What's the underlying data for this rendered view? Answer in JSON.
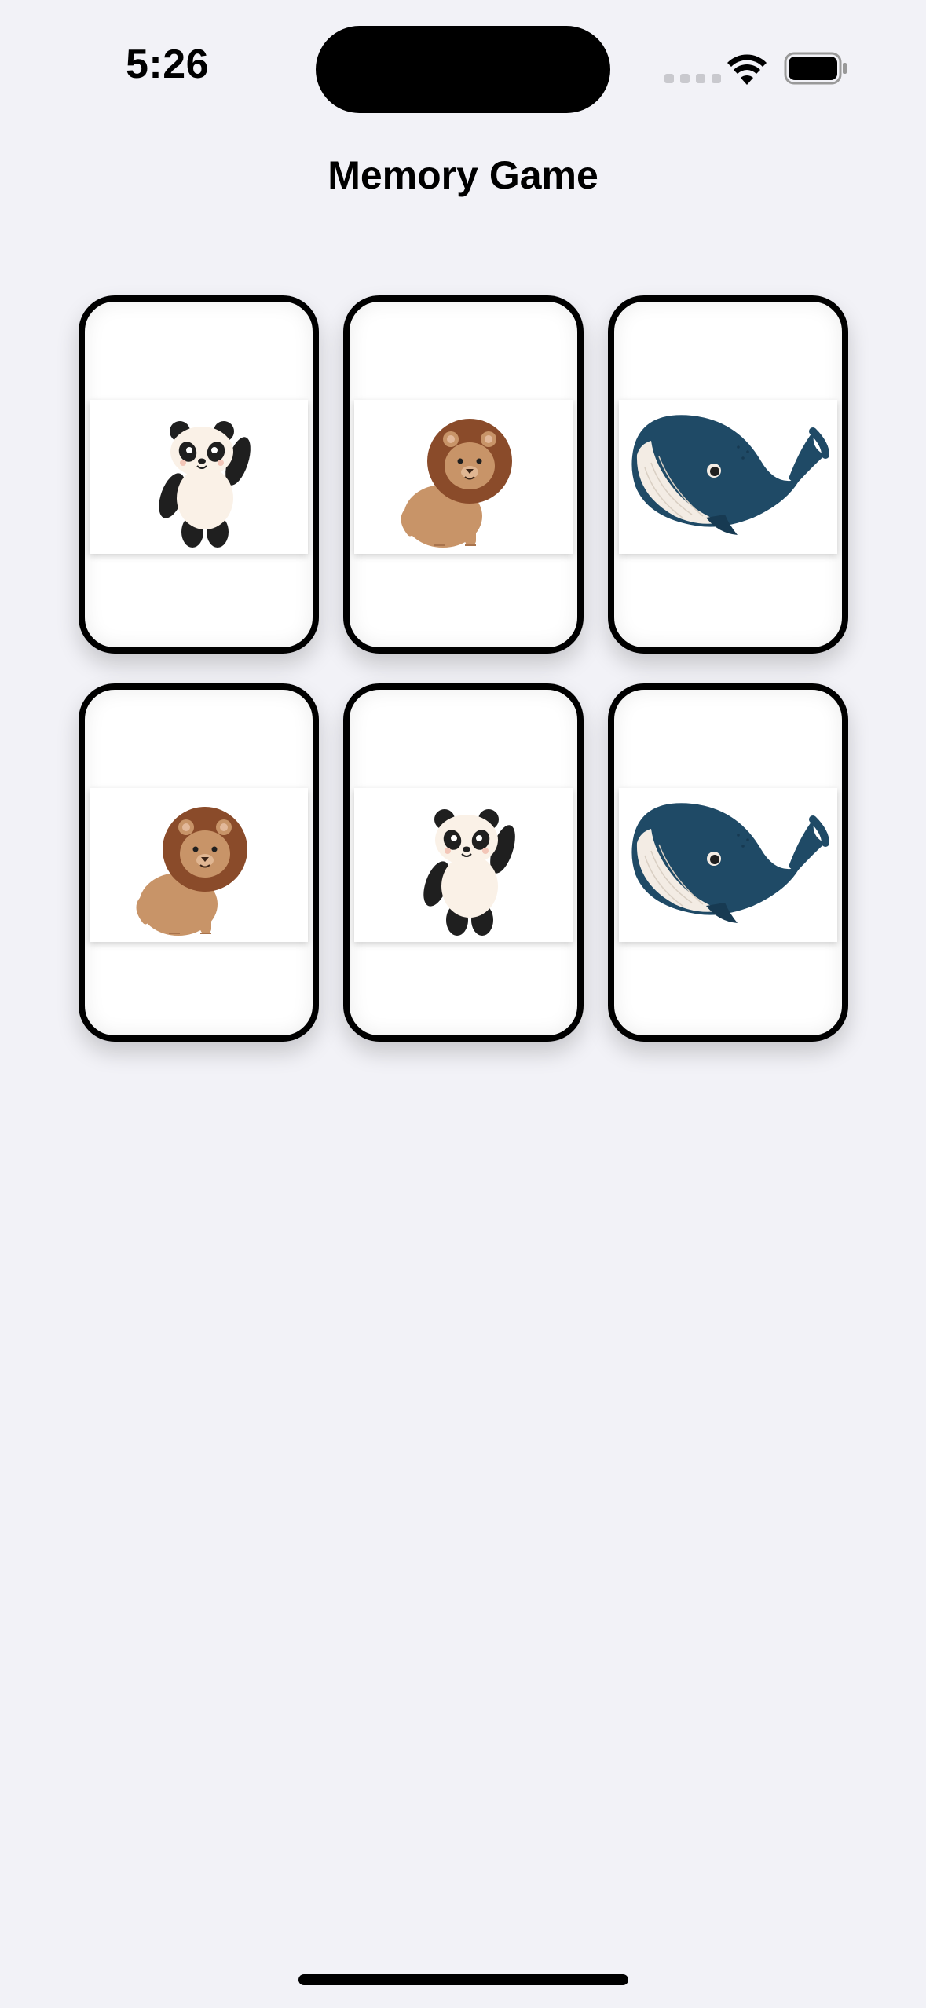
{
  "status_bar": {
    "time": "5:26",
    "icons": [
      "cellular-signal-icon",
      "wifi-icon",
      "battery-icon"
    ]
  },
  "title": "Memory Game",
  "cards": [
    {
      "animal": "panda",
      "face_up": true
    },
    {
      "animal": "lion",
      "face_up": true
    },
    {
      "animal": "whale",
      "face_up": true
    },
    {
      "animal": "lion",
      "face_up": true
    },
    {
      "animal": "panda",
      "face_up": true
    },
    {
      "animal": "whale",
      "face_up": true
    }
  ],
  "colors": {
    "background": "#f2f2f7",
    "card_border": "#000000",
    "card_fill": "#ffffff",
    "panda_black": "#1f1f1f",
    "lion_mane": "#8a4b2a",
    "lion_body": "#c89468",
    "whale_blue": "#1f4a66",
    "whale_belly": "#f3ece4"
  }
}
